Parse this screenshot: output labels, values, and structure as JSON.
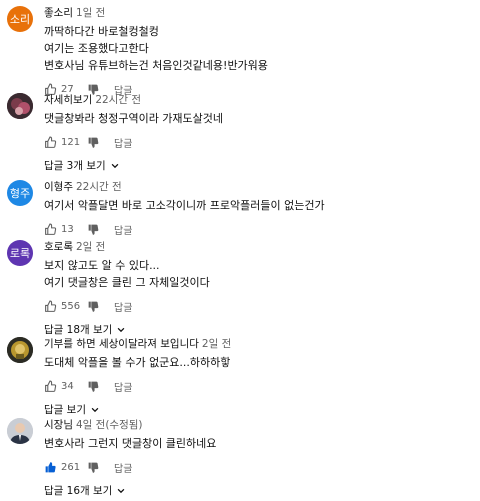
{
  "colors": {
    "like_active": "#065fd4",
    "muted": "#606060"
  },
  "comments": [
    {
      "author": "좋소리",
      "time": "1일 전",
      "avatar_text": "소리",
      "avatar_color": "#e8710a",
      "lines": [
        "까딱하다간 바로철컹철컹",
        "여기는 조용했다고한다",
        "변호사님 유튜브하는건 처음인것같네용!반가워용"
      ],
      "likes": "27",
      "reply_label": "답글",
      "like_icon": "thumb-up-outline-icon",
      "replies_label": ""
    },
    {
      "author": "자세히보기",
      "time": "22시간 전",
      "avatar_text": "",
      "avatar_color": "#3a2a30",
      "lines": [
        "댓글창봐라 청정구역이라 가재도살것네"
      ],
      "likes": "121",
      "reply_label": "답글",
      "like_icon": "thumb-up-outline-icon",
      "replies_label": "답글 3개 보기"
    },
    {
      "author": "이형주",
      "time": "22시간 전",
      "avatar_text": "형주",
      "avatar_color": "#1e88e5",
      "lines": [
        "여기서 악플달면 바로 고소각이니까 프로악플러들이 없는건가"
      ],
      "likes": "13",
      "reply_label": "답글",
      "like_icon": "thumb-up-outline-icon",
      "replies_label": ""
    },
    {
      "author": "호로록",
      "time": "2일 전",
      "avatar_text": "로록",
      "avatar_color": "#5e35b1",
      "lines": [
        "보지 않고도 알 수 있다...",
        "여기 댓글창은 클린 그 자체일것이다"
      ],
      "likes": "556",
      "reply_label": "답글",
      "like_icon": "thumb-up-outline-icon",
      "replies_label": "답글 18개 보기"
    },
    {
      "author": "기부를 하면 세상이달라져 보입니다",
      "time": "2일 전",
      "avatar_text": "",
      "avatar_color": "#2b2b24",
      "lines": [
        "도대체 악플을 볼 수가 없군요...하하하핳"
      ],
      "likes": "34",
      "reply_label": "답글",
      "like_icon": "thumb-up-outline-icon",
      "replies_label": "답글 보기"
    },
    {
      "author": "시장님",
      "time": "4일 전(수정됨)",
      "avatar_text": "",
      "avatar_color": "#c9cdd4",
      "lines": [
        "변호사라 그런지 댓글창이 클린하네요"
      ],
      "likes": "261",
      "reply_label": "답글",
      "like_icon": "thumb-up-filled-icon",
      "replies_label": "답글 16개 보기"
    }
  ]
}
